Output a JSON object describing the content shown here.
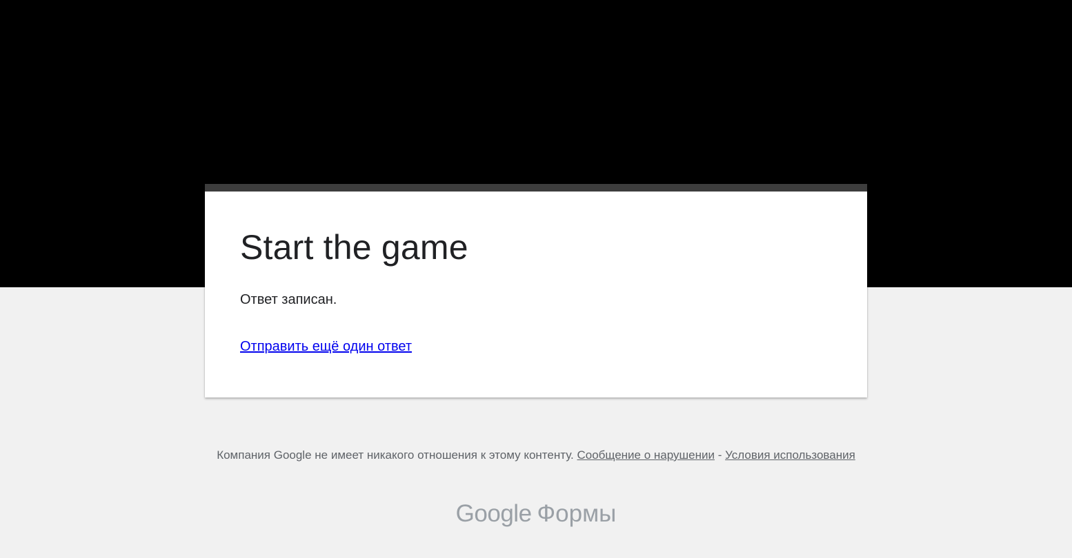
{
  "form": {
    "title": "Start the game",
    "confirmation_message": "Ответ записан.",
    "submit_another_link": "Отправить ещё один ответ"
  },
  "footer": {
    "disclaimer": "Компания Google не имеет никакого отношения к этому контенту.",
    "report_abuse_link": "Сообщение о нарушении",
    "separator": " - ",
    "terms_link": "Условия использования"
  },
  "branding": {
    "logo_text": "Google",
    "product_text": "Формы"
  },
  "colors": {
    "header_band": "#000000",
    "card_topbar": "#3d3d3d",
    "page_background": "#f1f1f1",
    "link": "#0000ee"
  }
}
